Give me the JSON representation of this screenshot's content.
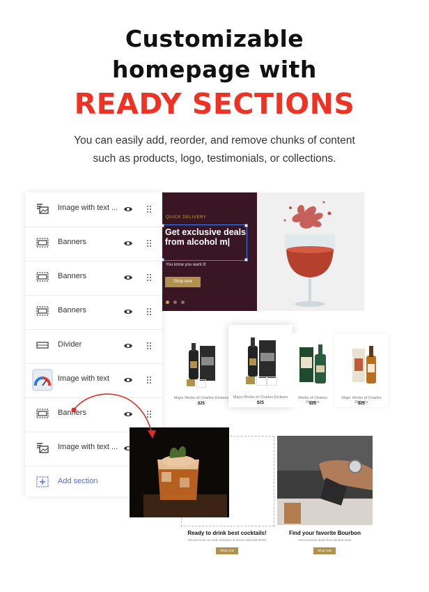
{
  "headline": {
    "line1": "Customizable",
    "line2": "homepage with",
    "line3": "READY SECTIONS",
    "accent_color": "#ee3224"
  },
  "subtitle": {
    "line1": "You can easily add, reorder, and remove chunks of content",
    "line2": "such as products, logo, testimonials, or collections."
  },
  "sections_panel": {
    "items": [
      {
        "label": "Image with text ...",
        "icon": "image-with-text-icon"
      },
      {
        "label": "Banners",
        "icon": "banner-icon"
      },
      {
        "label": "Banners",
        "icon": "banner-icon"
      },
      {
        "label": "Banners",
        "icon": "banner-icon"
      },
      {
        "label": "Divider",
        "icon": "divider-icon"
      },
      {
        "label": "Image with text",
        "icon": "image-with-text-icon"
      },
      {
        "label": "Banners",
        "icon": "banner-icon"
      },
      {
        "label": "Image with text ...",
        "icon": "image-with-text-icon"
      }
    ],
    "add_label": "Add section",
    "add_color": "#4a6cf7"
  },
  "hero": {
    "eyebrow": "QUICK DELIVERY",
    "heading": "Get exclusive deals from alcohol m|",
    "tagline": "You know you want it!",
    "button": "Shop now"
  },
  "products": [
    {
      "name": "Major Works of Charles Dickens",
      "price": "$25"
    },
    {
      "name": "Major Works of Charles Dickens",
      "price": "$25"
    },
    {
      "name": "Works of Charles Dickens",
      "price": "$25"
    },
    {
      "name": "Major Works of Charles Dickens",
      "price": "$25"
    }
  ],
  "cards": [
    {
      "title": "Ready to drink best cocktails!",
      "desc": "Choose from our wide selection of mixers and soft drinks",
      "button": "Shop now"
    },
    {
      "title": "Find your favorite Bourbon",
      "desc": "Get exclusive deals from alcohol man!",
      "button": "Shop now"
    }
  ]
}
